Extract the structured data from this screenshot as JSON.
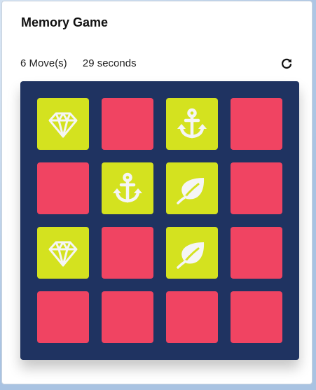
{
  "game": {
    "title": "Memory Game",
    "moves_text": "6 Move(s)",
    "timer_text": "29 seconds",
    "restart_icon": "restart-icon"
  },
  "colors": {
    "hidden": "#f04462",
    "revealed": "#d4e21f",
    "board": "#1f3361",
    "icon": "#f5f5f5"
  },
  "cards": [
    {
      "state": "revealed",
      "icon": "diamond"
    },
    {
      "state": "hidden",
      "icon": ""
    },
    {
      "state": "revealed",
      "icon": "anchor"
    },
    {
      "state": "hidden",
      "icon": ""
    },
    {
      "state": "hidden",
      "icon": ""
    },
    {
      "state": "revealed",
      "icon": "anchor"
    },
    {
      "state": "revealed",
      "icon": "leaf"
    },
    {
      "state": "hidden",
      "icon": ""
    },
    {
      "state": "revealed",
      "icon": "diamond"
    },
    {
      "state": "hidden",
      "icon": ""
    },
    {
      "state": "revealed",
      "icon": "leaf"
    },
    {
      "state": "hidden",
      "icon": ""
    },
    {
      "state": "hidden",
      "icon": ""
    },
    {
      "state": "hidden",
      "icon": ""
    },
    {
      "state": "hidden",
      "icon": ""
    },
    {
      "state": "hidden",
      "icon": ""
    }
  ]
}
